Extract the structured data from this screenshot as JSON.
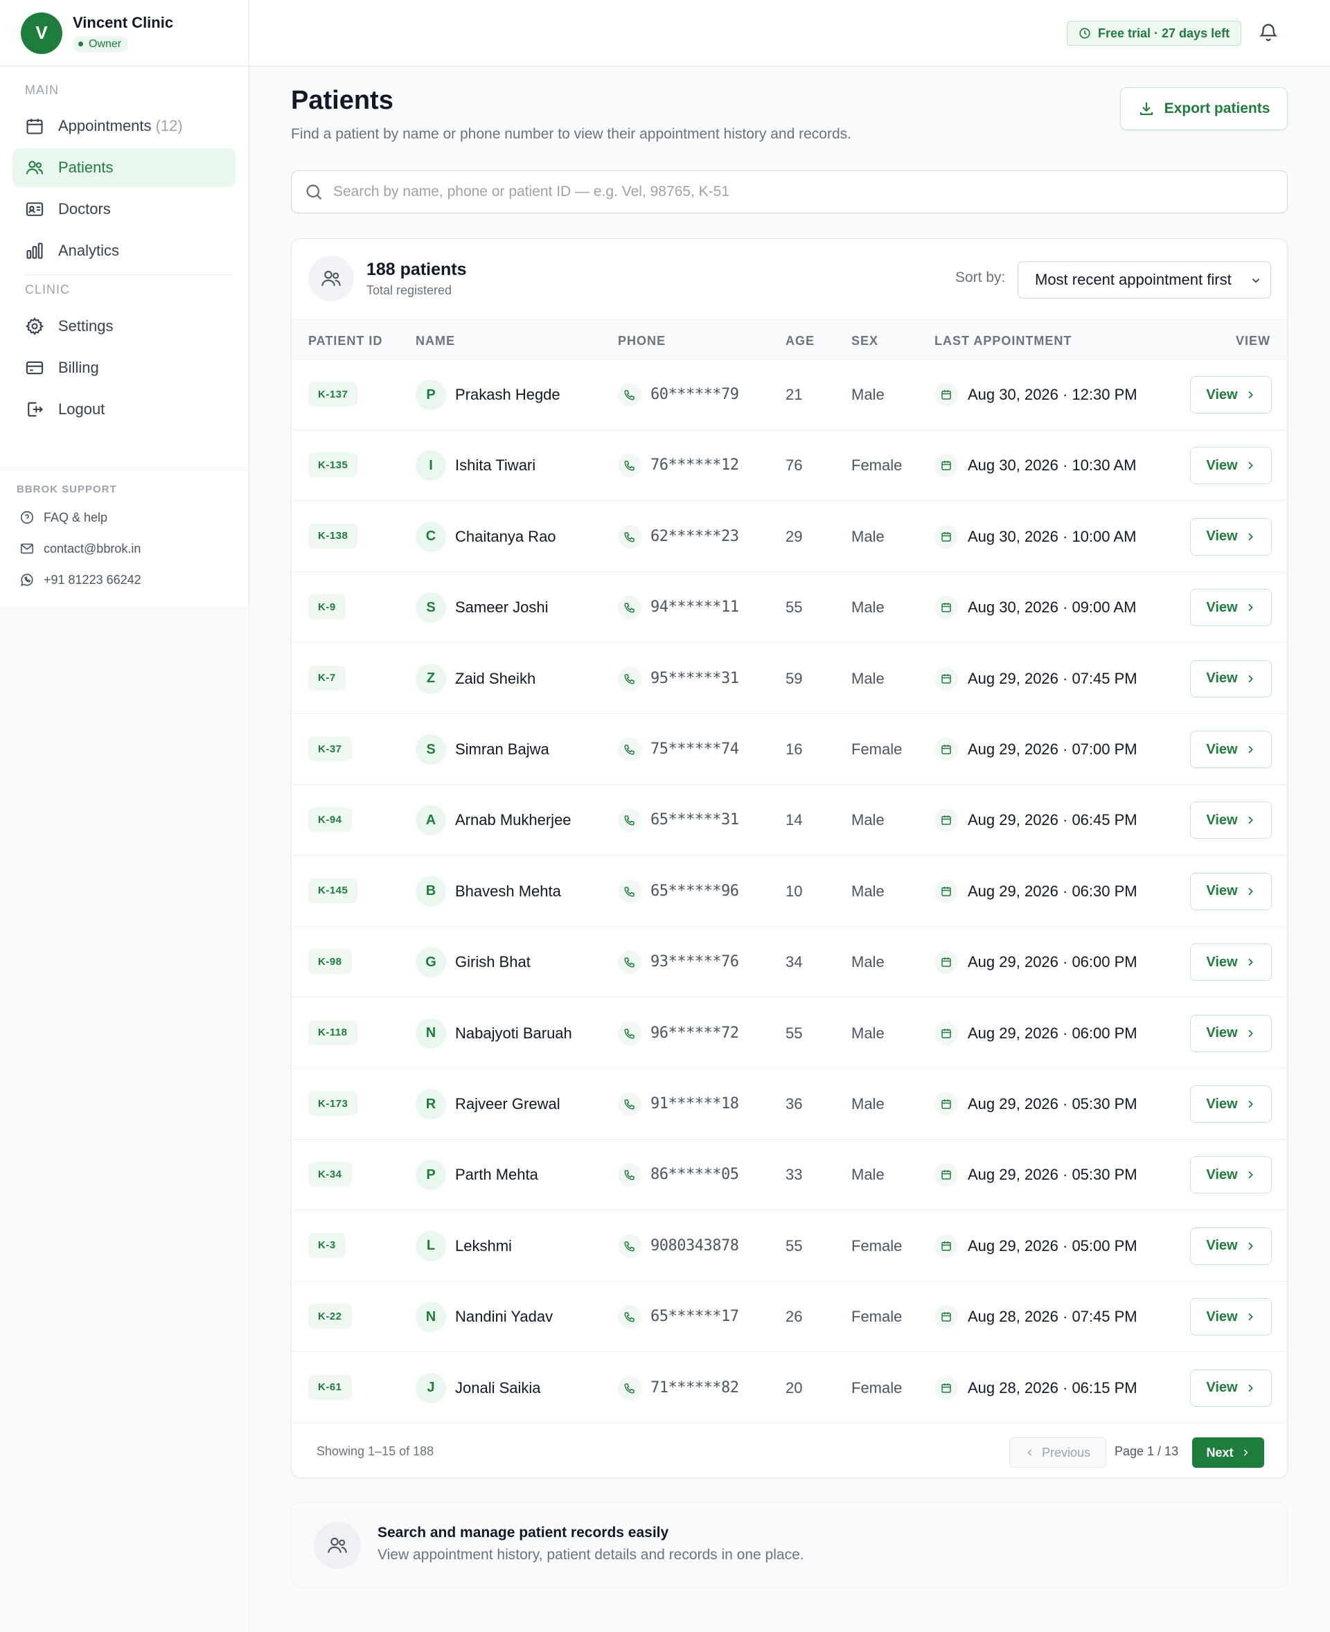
{
  "clinic": {
    "avatar_letter": "V",
    "name": "Vincent Clinic",
    "role": "Owner"
  },
  "sidebar": {
    "main_label": "MAIN",
    "clinic_label": "CLINIC",
    "items": [
      {
        "label": "Appointments",
        "count": "(12)",
        "icon": "calendar-icon"
      },
      {
        "label": "Patients",
        "icon": "users-icon",
        "active": true
      },
      {
        "label": "Doctors",
        "icon": "id-card-icon"
      },
      {
        "label": "Analytics",
        "icon": "bar-chart-icon"
      },
      {
        "label": "Settings",
        "icon": "gear-icon"
      },
      {
        "label": "Billing",
        "icon": "credit-card-icon"
      },
      {
        "label": "Logout",
        "icon": "logout-icon"
      }
    ],
    "support_label": "BBROK SUPPORT",
    "support": [
      {
        "label": "FAQ & help",
        "icon": "help-circle-icon"
      },
      {
        "label": "contact@bbrok.in",
        "icon": "mail-icon"
      },
      {
        "label": "+91 81223 66242",
        "icon": "whatsapp-icon"
      }
    ]
  },
  "topbar": {
    "trial": "Free trial · 27 days left"
  },
  "header": {
    "title": "Patients",
    "subtitle": "Find a patient by name or phone number to view their appointment history and records.",
    "export_label": "Export patients"
  },
  "search": {
    "placeholder": "Search by name, phone or patient ID — e.g. Vel, 98765, K-51",
    "value": ""
  },
  "summary": {
    "count": "188 patients",
    "sub": "Total registered",
    "sort_label": "Sort by:",
    "sort_value": "Most recent appointment first"
  },
  "table": {
    "columns": [
      "PATIENT ID",
      "NAME",
      "PHONE",
      "AGE",
      "SEX",
      "LAST APPOINTMENT",
      "VIEW"
    ],
    "view_label": "View",
    "rows": [
      {
        "id": "K-137",
        "initial": "P",
        "name": "Prakash Hegde",
        "phone": "60******79",
        "age": "21",
        "sex": "Male",
        "last": "Aug 30, 2026 · 12:30 PM"
      },
      {
        "id": "K-135",
        "initial": "I",
        "name": "Ishita Tiwari",
        "phone": "76******12",
        "age": "76",
        "sex": "Female",
        "last": "Aug 30, 2026 · 10:30 AM"
      },
      {
        "id": "K-138",
        "initial": "C",
        "name": "Chaitanya Rao",
        "phone": "62******23",
        "age": "29",
        "sex": "Male",
        "last": "Aug 30, 2026 · 10:00 AM"
      },
      {
        "id": "K-9",
        "initial": "S",
        "name": "Sameer Joshi",
        "phone": "94******11",
        "age": "55",
        "sex": "Male",
        "last": "Aug 30, 2026 · 09:00 AM"
      },
      {
        "id": "K-7",
        "initial": "Z",
        "name": "Zaid Sheikh",
        "phone": "95******31",
        "age": "59",
        "sex": "Male",
        "last": "Aug 29, 2026 · 07:45 PM"
      },
      {
        "id": "K-37",
        "initial": "S",
        "name": "Simran Bajwa",
        "phone": "75******74",
        "age": "16",
        "sex": "Female",
        "last": "Aug 29, 2026 · 07:00 PM"
      },
      {
        "id": "K-94",
        "initial": "A",
        "name": "Arnab Mukherjee",
        "phone": "65******31",
        "age": "14",
        "sex": "Male",
        "last": "Aug 29, 2026 · 06:45 PM"
      },
      {
        "id": "K-145",
        "initial": "B",
        "name": "Bhavesh Mehta",
        "phone": "65******96",
        "age": "10",
        "sex": "Male",
        "last": "Aug 29, 2026 · 06:30 PM"
      },
      {
        "id": "K-98",
        "initial": "G",
        "name": "Girish Bhat",
        "phone": "93******76",
        "age": "34",
        "sex": "Male",
        "last": "Aug 29, 2026 · 06:00 PM"
      },
      {
        "id": "K-118",
        "initial": "N",
        "name": "Nabajyoti Baruah",
        "phone": "96******72",
        "age": "55",
        "sex": "Male",
        "last": "Aug 29, 2026 · 06:00 PM"
      },
      {
        "id": "K-173",
        "initial": "R",
        "name": "Rajveer Grewal",
        "phone": "91******18",
        "age": "36",
        "sex": "Male",
        "last": "Aug 29, 2026 · 05:30 PM"
      },
      {
        "id": "K-34",
        "initial": "P",
        "name": "Parth Mehta",
        "phone": "86******05",
        "age": "33",
        "sex": "Male",
        "last": "Aug 29, 2026 · 05:30 PM"
      },
      {
        "id": "K-3",
        "initial": "L",
        "name": "Lekshmi",
        "phone": "9080343878",
        "age": "55",
        "sex": "Female",
        "last": "Aug 29, 2026 · 05:00 PM"
      },
      {
        "id": "K-22",
        "initial": "N",
        "name": "Nandini Yadav",
        "phone": "65******17",
        "age": "26",
        "sex": "Female",
        "last": "Aug 28, 2026 · 07:45 PM"
      },
      {
        "id": "K-61",
        "initial": "J",
        "name": "Jonali Saikia",
        "phone": "71******82",
        "age": "20",
        "sex": "Female",
        "last": "Aug 28, 2026 · 06:15 PM"
      }
    ]
  },
  "pagination": {
    "showing": "Showing 1–15 of 188",
    "previous": "Previous",
    "page": "Page 1 / 13",
    "next": "Next"
  },
  "info": {
    "title": "Search and manage patient records easily",
    "subtitle": "View appointment history, patient details and records in one place."
  },
  "colors": {
    "brand": "#1e7d3c",
    "brand_light": "#e9f7ee"
  }
}
